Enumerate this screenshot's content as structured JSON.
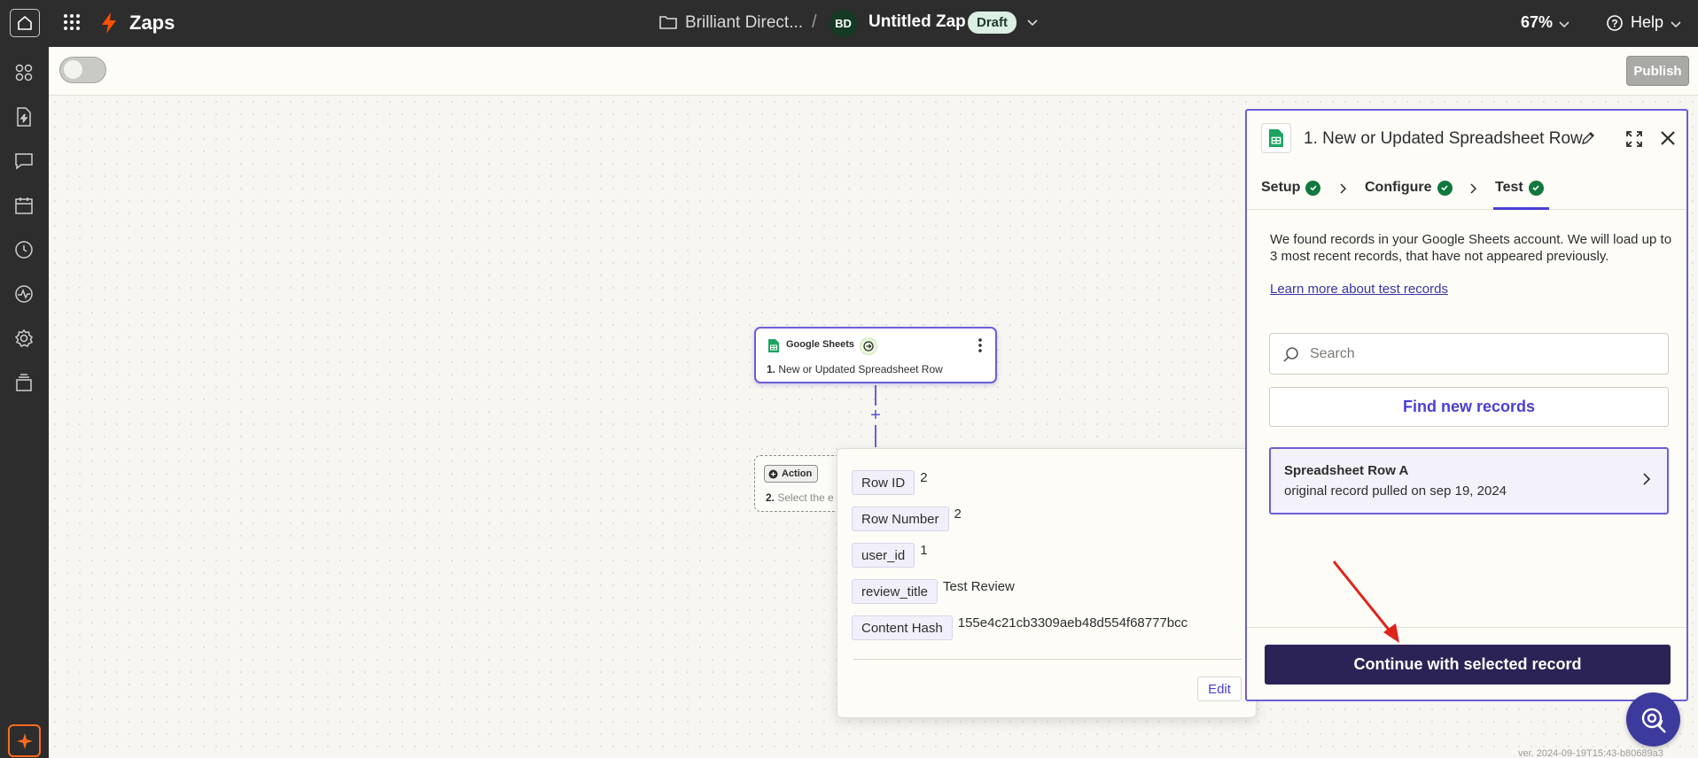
{
  "topbar": {
    "brand": "Zaps",
    "folder_name": "Brilliant Direct...",
    "separator": "/",
    "owner_initials": "BD",
    "zap_name": "Untitled Zap",
    "status_badge": "Draft",
    "zoom": "67%",
    "help": "Help"
  },
  "toolbar": {
    "publish_label": "Publish"
  },
  "canvas": {
    "trigger_node": {
      "app": "Google Sheets",
      "step_number": "1.",
      "step_title": "New or Updated Spreadsheet Row"
    },
    "add_step": "+",
    "action_node": {
      "chip": "Action",
      "step_number": "2.",
      "step_text": "Select the e"
    }
  },
  "popover": {
    "fields": [
      {
        "key": "Row ID",
        "value": "2"
      },
      {
        "key": "Row Number",
        "value": "2"
      },
      {
        "key": "user_id",
        "value": "1"
      },
      {
        "key": "review_title",
        "value": "Test Review"
      },
      {
        "key": "Content Hash",
        "value": "155e4c21cb3309aeb48d554f68777bcc"
      }
    ],
    "edit_label": "Edit"
  },
  "panel": {
    "title": "1. New or Updated Spreadsheet Row",
    "tabs": [
      {
        "label": "Setup"
      },
      {
        "label": "Configure"
      },
      {
        "label": "Test"
      }
    ],
    "description": "We found records in your Google Sheets account. We will load up to 3 most recent records, that have not appeared previously.",
    "learn_more": "Learn more about test records",
    "search_placeholder": "Search",
    "find_button": "Find new records",
    "record": {
      "title": "Spreadsheet Row A",
      "subtitle": "original record pulled on sep 19, 2024"
    },
    "continue_button": "Continue with selected record"
  },
  "version": "ver. 2024-09-19T15:43-b80689a3",
  "colors": {
    "accent": "#6c5ed6",
    "primary_button": "#2b2355",
    "success": "#11783e",
    "brand_orange": "#ff4f00",
    "annotation_arrow": "#e0231c"
  }
}
